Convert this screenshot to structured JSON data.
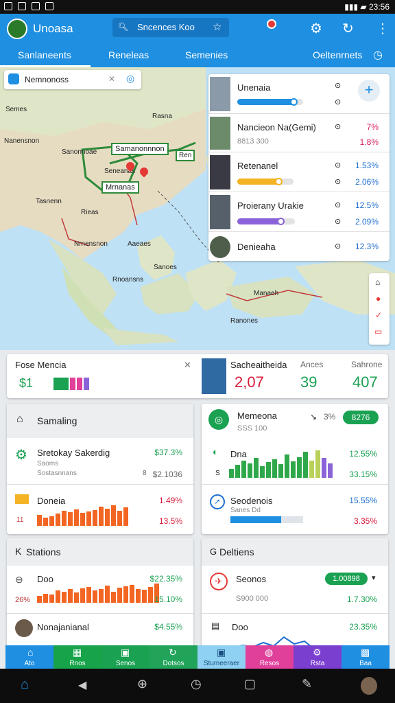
{
  "status": {
    "time": "23:56"
  },
  "appbar": {
    "title": "Unoasa",
    "search_text": "Sncences Koo"
  },
  "tabs": [
    "Sanlaneents",
    "Reneleas",
    "Semenies",
    "Oeltenrnets"
  ],
  "map": {
    "search_label": "Nemnonoss",
    "labels": [
      "Samanonnnon",
      "Mrnanas",
      "Nanensnon",
      "Ren",
      "Tasnenn",
      "Rieas",
      "Sanonnoae",
      "Seneanas",
      "Aaeaes",
      "Sanoes",
      "Rnoansns",
      "Manaeh",
      "Ranones",
      "Semes",
      "Rasna",
      "Nrnensnon"
    ]
  },
  "routes_panel": {
    "items": [
      {
        "title": "Unenaia",
        "sub": "",
        "v1": "",
        "v2": "",
        "bar_color": "#1e8fe1",
        "fill": 0.9
      },
      {
        "title": "Nancieon Na(Gemi)",
        "sub": "8813 300",
        "v1": "7%",
        "v2": "1.8%",
        "bar_color": "",
        "fill": 0
      },
      {
        "title": "Retenanel",
        "sub": "",
        "v1": "1.53%",
        "v2": "2.06%",
        "bar_color": "#f4b324",
        "fill": 0.78
      },
      {
        "title": "Proierany Urakie",
        "sub": "",
        "v1": "12.5%",
        "v2": "2.09%",
        "bar_color": "#8b63d8",
        "fill": 0.8
      },
      {
        "title": "Denieaha",
        "sub": "",
        "v1": "12.3%",
        "v2": "",
        "bar_color": "",
        "fill": 0
      }
    ]
  },
  "info_strip": {
    "title": "Fose Mencia",
    "left_num": "$1",
    "person_label": "Sacheaitheida",
    "col2_label": "Ances",
    "col3_label": "Sahrone",
    "v1": "2,07",
    "v2": "39",
    "v3": "407"
  },
  "panel_left_top": {
    "header": "Samaling",
    "row1": {
      "title": "Sretokay Sakerdig",
      "sub1": "Saoms",
      "sub2": "Sostasnnans",
      "v1": "$37.3%",
      "v2": "$2.1036",
      "mid": "8"
    },
    "row2": {
      "title": "Doneia",
      "left": "11",
      "v1": "1.49%",
      "v2": "13.5%",
      "values": [
        40,
        30,
        35,
        45,
        55,
        50,
        60,
        48,
        52,
        58,
        70,
        62,
        75,
        55,
        68
      ]
    }
  },
  "panel_right_top": {
    "header": "Memeona",
    "sub": "SSS 100",
    "pct": "3%",
    "badge": "8276",
    "row1": {
      "title": "Dna",
      "left": "S",
      "v1": "12.55%",
      "v2": "33.15%",
      "values": [
        30,
        45,
        60,
        50,
        70,
        40,
        55,
        65,
        48,
        80,
        58,
        72,
        90,
        60,
        95,
        70,
        50
      ]
    },
    "row2": {
      "title": "Seodenois",
      "sub": "Sanes Dd",
      "v1": "15.55%",
      "v2": "3.35%"
    }
  },
  "panel_left_bottom": {
    "header": "Stations",
    "row1": {
      "title": "Doo",
      "left": "26%",
      "v1": "$22.35%",
      "v2": "15.10%",
      "values": [
        30,
        40,
        35,
        55,
        50,
        60,
        45,
        65,
        70,
        55,
        60,
        75,
        50,
        68,
        72,
        80,
        62,
        58,
        70,
        85
      ]
    },
    "row2": {
      "title": "Nonajanianal",
      "v1": "$4.55%"
    }
  },
  "panel_right_bottom": {
    "header": "Deltiens",
    "row1": {
      "title": "Seonos",
      "sub": "S900 000",
      "badge": "1.00898",
      "v2": "1.7.30%"
    },
    "row2": {
      "title": "Doo",
      "v1": "23.35%"
    }
  },
  "bottomnav": [
    {
      "label": "Ato",
      "color": "#1e8fe1"
    },
    {
      "label": "Rnos",
      "color": "#16a34a"
    },
    {
      "label": "Senos",
      "color": "#1aa152"
    },
    {
      "label": "Dotsos",
      "color": "#21a35a"
    },
    {
      "label": "Stumeeraer",
      "color": "#8ed1f2"
    },
    {
      "label": "Resos",
      "color": "#e0409a"
    },
    {
      "label": "Rsta",
      "color": "#7b3fd0"
    },
    {
      "label": "Baa",
      "color": "#1e8fe1"
    }
  ]
}
